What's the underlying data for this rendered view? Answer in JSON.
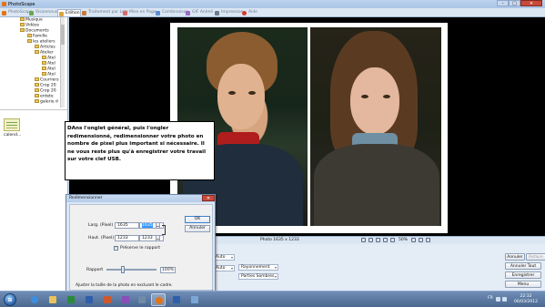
{
  "window": {
    "title": "PhotoScape"
  },
  "tabs": [
    {
      "label": "PhotoScape",
      "icon": "photoscape-icon",
      "active": false
    },
    {
      "label": "Visionneuse",
      "icon": "viewer-icon",
      "active": false
    },
    {
      "label": "Edition",
      "icon": "editor-icon",
      "active": true
    },
    {
      "label": "Traitement par Lots",
      "icon": "batch-icon",
      "active": false
    },
    {
      "label": "Mise en Page",
      "icon": "page-icon",
      "active": false
    },
    {
      "label": "Combinaison",
      "icon": "combine-icon",
      "active": false
    },
    {
      "label": "GIF Animé",
      "icon": "gif-icon",
      "active": false
    },
    {
      "label": "Impression",
      "icon": "print-icon",
      "active": false
    },
    {
      "label": "Aide",
      "icon": "help-icon",
      "active": false
    }
  ],
  "tree": [
    "Musique",
    "Vidéos",
    "Documents",
    "Famille",
    "les ateliers",
    "Articles",
    "Atelier",
    "Atel",
    "Atel",
    "Atel",
    "Atel",
    "Courriers",
    "Crop 20",
    "Crop 20",
    "entete",
    "galerie d"
  ],
  "thumbnails": [
    {
      "label": "calend..."
    }
  ],
  "note": {
    "text": "DAns l'onglet général, puis l'ongler redimensionné, redimensionner votre photo en nombre de pixel plus important si nécessaire. Il ne vous reste plus qu'à enregistrer votre travail sur votre clef USB."
  },
  "info": {
    "photo_size": "Photo 1635 x 1233",
    "zoom": "50%"
  },
  "bottom": {
    "combos": [
      "Auto",
      "Auto",
      "Rayonnement",
      "Parties Sombres"
    ],
    "buttons": {
      "annuler": "Annuler",
      "refaire": "Refaire",
      "annuler_tout": "Annuler Tout",
      "enregistrer": "Enregistrer",
      "menu": "Menu"
    }
  },
  "dialog": {
    "title": "Redimensionner",
    "width_label": "Larg. (Pixel)",
    "height_label": "Haut. (Pixel)",
    "orig_width": "1635",
    "orig_height": "1233",
    "new_width": "1635",
    "new_height": "1233",
    "keep_ratio_label": "Préserve le rapport",
    "keep_ratio_checked": true,
    "ratio_label": "Rapport",
    "ratio_value": "100%",
    "hint": "Ajuster la taille de la photo en excluant le cadre.",
    "ok": "OK",
    "cancel": "Annuler"
  },
  "taskbar": {
    "lang": "FR",
    "time": "22:32",
    "date": "06/03/2012"
  }
}
